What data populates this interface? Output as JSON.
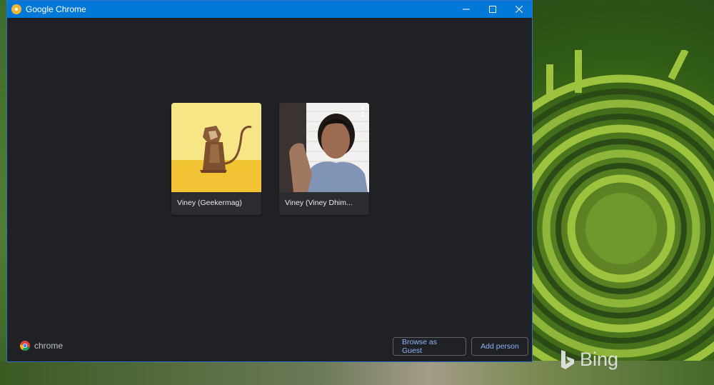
{
  "window": {
    "title": "Google Chrome",
    "controls": [
      "minimize-icon",
      "maximize-icon",
      "close-icon"
    ],
    "title_bar_color": "#0078d7",
    "background_color": "#202124"
  },
  "profiles": [
    {
      "name": "Viney (Geekermag)",
      "avatar": "origami-monkey-avatar",
      "has_menu": false
    },
    {
      "name": "Viney (Viney Dhim...",
      "avatar": "photo-avatar",
      "has_menu": true
    }
  ],
  "footer": {
    "brand": "chrome",
    "browse_as_guest_label": "Browse as Guest",
    "add_person_label": "Add person",
    "accent_color": "#8ab4f8"
  },
  "desktop": {
    "wallpaper_brand": "Bing"
  }
}
